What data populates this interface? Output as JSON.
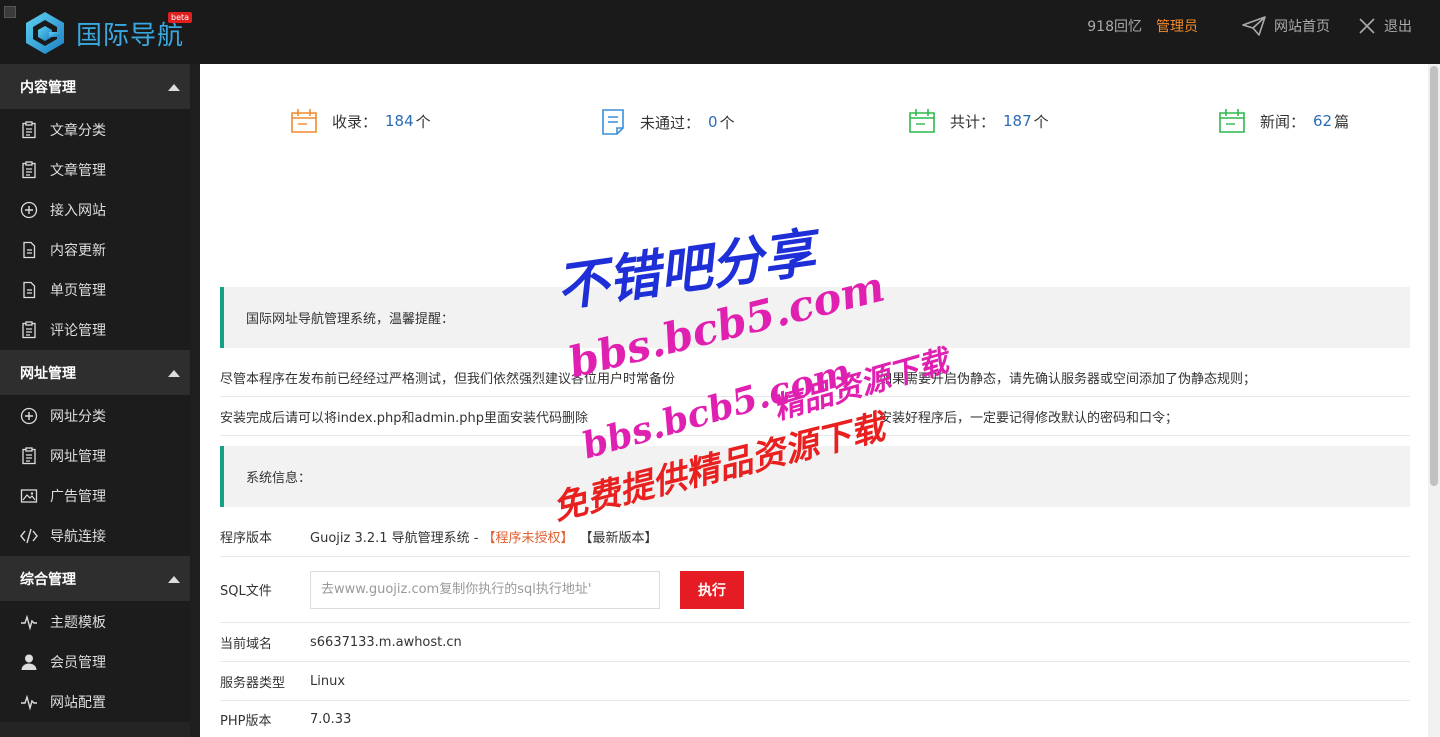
{
  "header": {
    "logo_text": "国际导航",
    "beta": "beta",
    "username": "918回忆",
    "role": "管理员",
    "home_link": "网站首页",
    "logout_link": "退出"
  },
  "sidebar": {
    "groups": [
      {
        "label": "内容管理",
        "items": [
          {
            "label": "文章分类",
            "icon": "clipboard-icon"
          },
          {
            "label": "文章管理",
            "icon": "clipboard-icon"
          },
          {
            "label": "接入网站",
            "icon": "plus-circle-icon"
          },
          {
            "label": "内容更新",
            "icon": "document-icon"
          },
          {
            "label": "单页管理",
            "icon": "document-icon"
          },
          {
            "label": "评论管理",
            "icon": "clipboard-icon"
          }
        ]
      },
      {
        "label": "网址管理",
        "items": [
          {
            "label": "网址分类",
            "icon": "plus-circle-icon"
          },
          {
            "label": "网址管理",
            "icon": "clipboard-icon"
          },
          {
            "label": "广告管理",
            "icon": "image-icon"
          },
          {
            "label": "导航连接",
            "icon": "code-icon"
          }
        ]
      },
      {
        "label": "综合管理",
        "items": [
          {
            "label": "主题模板",
            "icon": "pulse-icon"
          },
          {
            "label": "会员管理",
            "icon": "user-icon"
          },
          {
            "label": "网站配置",
            "icon": "pulse-icon"
          }
        ]
      }
    ]
  },
  "stats": [
    {
      "label": "收录：",
      "value": "184",
      "unit": "个",
      "icon": "folder-icon",
      "color": "#f08a2c"
    },
    {
      "label": "未通过：",
      "value": "0",
      "unit": "个",
      "icon": "note-icon",
      "color": "#3a8fd8"
    },
    {
      "label": "共计：",
      "value": "187",
      "unit": "个",
      "icon": "folder-icon",
      "color": "#2db84d"
    },
    {
      "label": "新闻：",
      "value": "62",
      "unit": "篇",
      "icon": "folder-icon",
      "color": "#2db84d"
    }
  ],
  "notice": {
    "title": "国际网址导航管理系统，温馨提醒：",
    "rows": [
      [
        "尽管本程序在发布前已经经过严格测试，但我们依然强烈建议各位用户时常备份",
        "如果需要开启伪静态，请先确认服务器或空间添加了伪静态规则；"
      ],
      [
        "安装完成后请可以将index.php和admin.php里面安装代码删除",
        "安装好程序后，一定要记得修改默认的密码和口令；"
      ]
    ]
  },
  "sysinfo": {
    "title": "系统信息：",
    "version_label": "程序版本",
    "version_text": "Guojiz 3.2.1 导航管理系统 -",
    "license_status": "【程序未授权】",
    "latest": "【最新版本】",
    "sql_label": "SQL文件",
    "sql_placeholder": "去www.guojiz.com复制你执行的sql执行地址'",
    "run_button": "执行",
    "domain_label": "当前域名",
    "domain_value": "s6637133.m.awhost.cn",
    "server_label": "服务器类型",
    "server_value": "Linux",
    "php_label": "PHP版本",
    "php_value": "7.0.33"
  },
  "watermark": {
    "line1": "不错吧分享",
    "line2": "bbs.bcb5.com",
    "line3": "bbs.bcb5.com",
    "line4": "精品资源下载",
    "line5": "免费提供精品资源下载"
  },
  "colors": {
    "accent_teal": "#16a085",
    "header_bg": "#1a1a1a",
    "sidebar_bg": "#242424",
    "role_orange": "#f08a2c",
    "run_red": "#e51c23",
    "link_blue": "#2b6cb5"
  }
}
